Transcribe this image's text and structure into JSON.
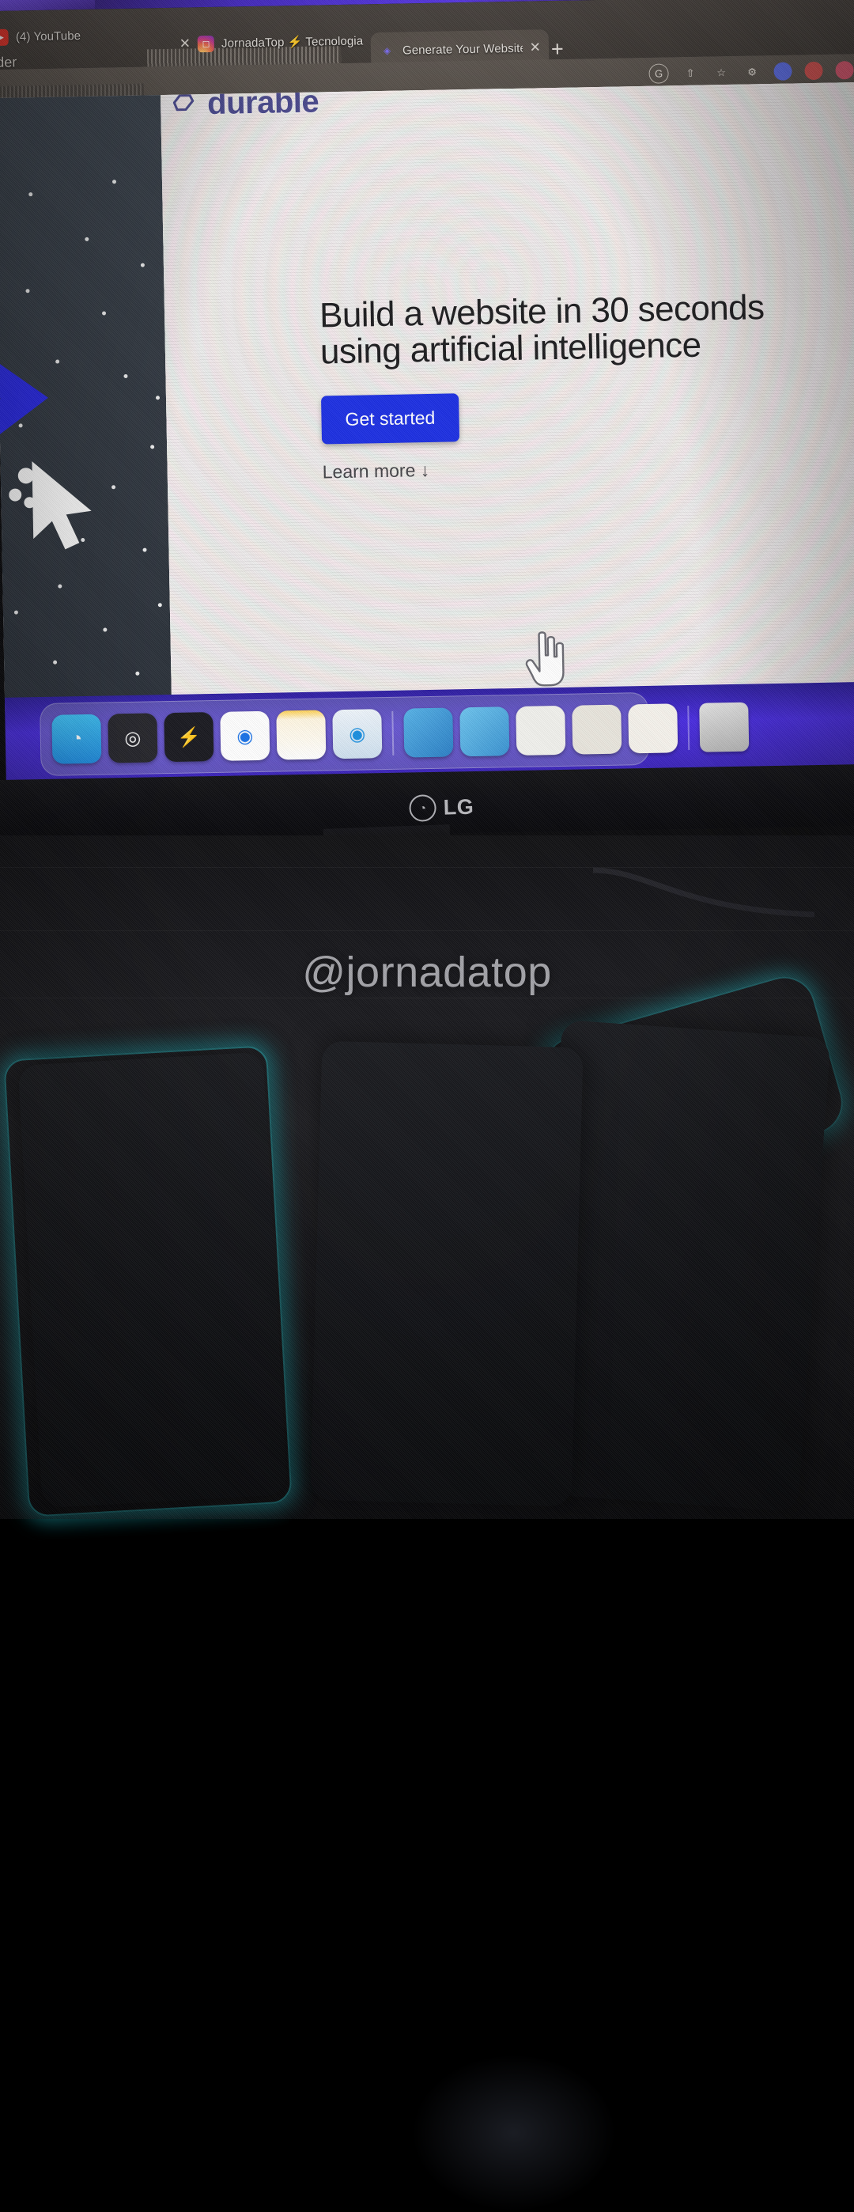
{
  "browser": {
    "tabs": [
      {
        "id": "youtube",
        "label": "(4) YouTube",
        "favicon": "youtube-icon",
        "close_label": "✕",
        "active": false
      },
      {
        "id": "instagram",
        "label": "JornadaTop ⚡ Tecnologia (@|",
        "favicon": "instagram-icon",
        "close_label": "✕",
        "active": false
      },
      {
        "id": "durable",
        "label": "Generate Your Website with AI",
        "favicon": "durable-icon",
        "close_label": "✕",
        "active": true
      }
    ],
    "new_tab_label": "+",
    "background_tab_label": "-builder",
    "toolbar_icons": [
      {
        "name": "google-account-icon",
        "glyph": "G"
      },
      {
        "name": "share-icon",
        "glyph": "⇧"
      },
      {
        "name": "bookmark-star-icon",
        "glyph": "☆"
      },
      {
        "name": "gear-extension-icon",
        "glyph": "⚙"
      },
      {
        "name": "extension-blue-icon",
        "glyph": ""
      },
      {
        "name": "extension-red-icon",
        "glyph": ""
      },
      {
        "name": "extension-pink-icon",
        "glyph": ""
      }
    ]
  },
  "page": {
    "brand_name": "durable",
    "headline_line1": "Build a website in 30 seconds",
    "headline_line2": "using artificial intelligence",
    "cta_label": "Get started",
    "learn_more_label": "Learn more ↓"
  },
  "dock": {
    "items": [
      {
        "name": "finder-icon",
        "label": "Finder",
        "glyph": "◔",
        "running": true
      },
      {
        "name": "obs-icon",
        "label": "OBS",
        "glyph": "◎",
        "running": true
      },
      {
        "name": "submagic-icon",
        "label": "Submagic",
        "glyph": "⚡",
        "running": true
      },
      {
        "name": "chrome-icon",
        "label": "Chrome",
        "glyph": "◉",
        "running": true
      },
      {
        "name": "notes-icon",
        "label": "Notes",
        "glyph": "",
        "running": false
      },
      {
        "name": "safari-icon",
        "label": "Safari",
        "glyph": "◉",
        "running": true
      },
      {
        "name": "window-1-icon",
        "label": "Window",
        "glyph": "",
        "running": false
      },
      {
        "name": "window-2-icon",
        "label": "Window",
        "glyph": "",
        "running": false
      },
      {
        "name": "spreadsheet-icon",
        "label": "Spreadsheet",
        "glyph": "",
        "running": false
      },
      {
        "name": "preview-icon",
        "label": "Preview",
        "glyph": "",
        "running": true
      },
      {
        "name": "document-icon",
        "label": "Document",
        "glyph": "",
        "running": false
      },
      {
        "name": "trash-icon",
        "label": "Trash",
        "glyph": "",
        "running": false
      }
    ]
  },
  "monitor": {
    "brand_label": "LG",
    "brand_mark": "◔"
  },
  "overlay": {
    "watermark": "@jornadatop"
  },
  "colors": {
    "brand_purple": "#4b4a8f",
    "cta_blue": "#1d30e3",
    "dock_glow": "#4a2ee0",
    "chrome_bar": "#4a4440",
    "page_bg": "#eceae9",
    "phone_glow": "#2ee1ec"
  }
}
